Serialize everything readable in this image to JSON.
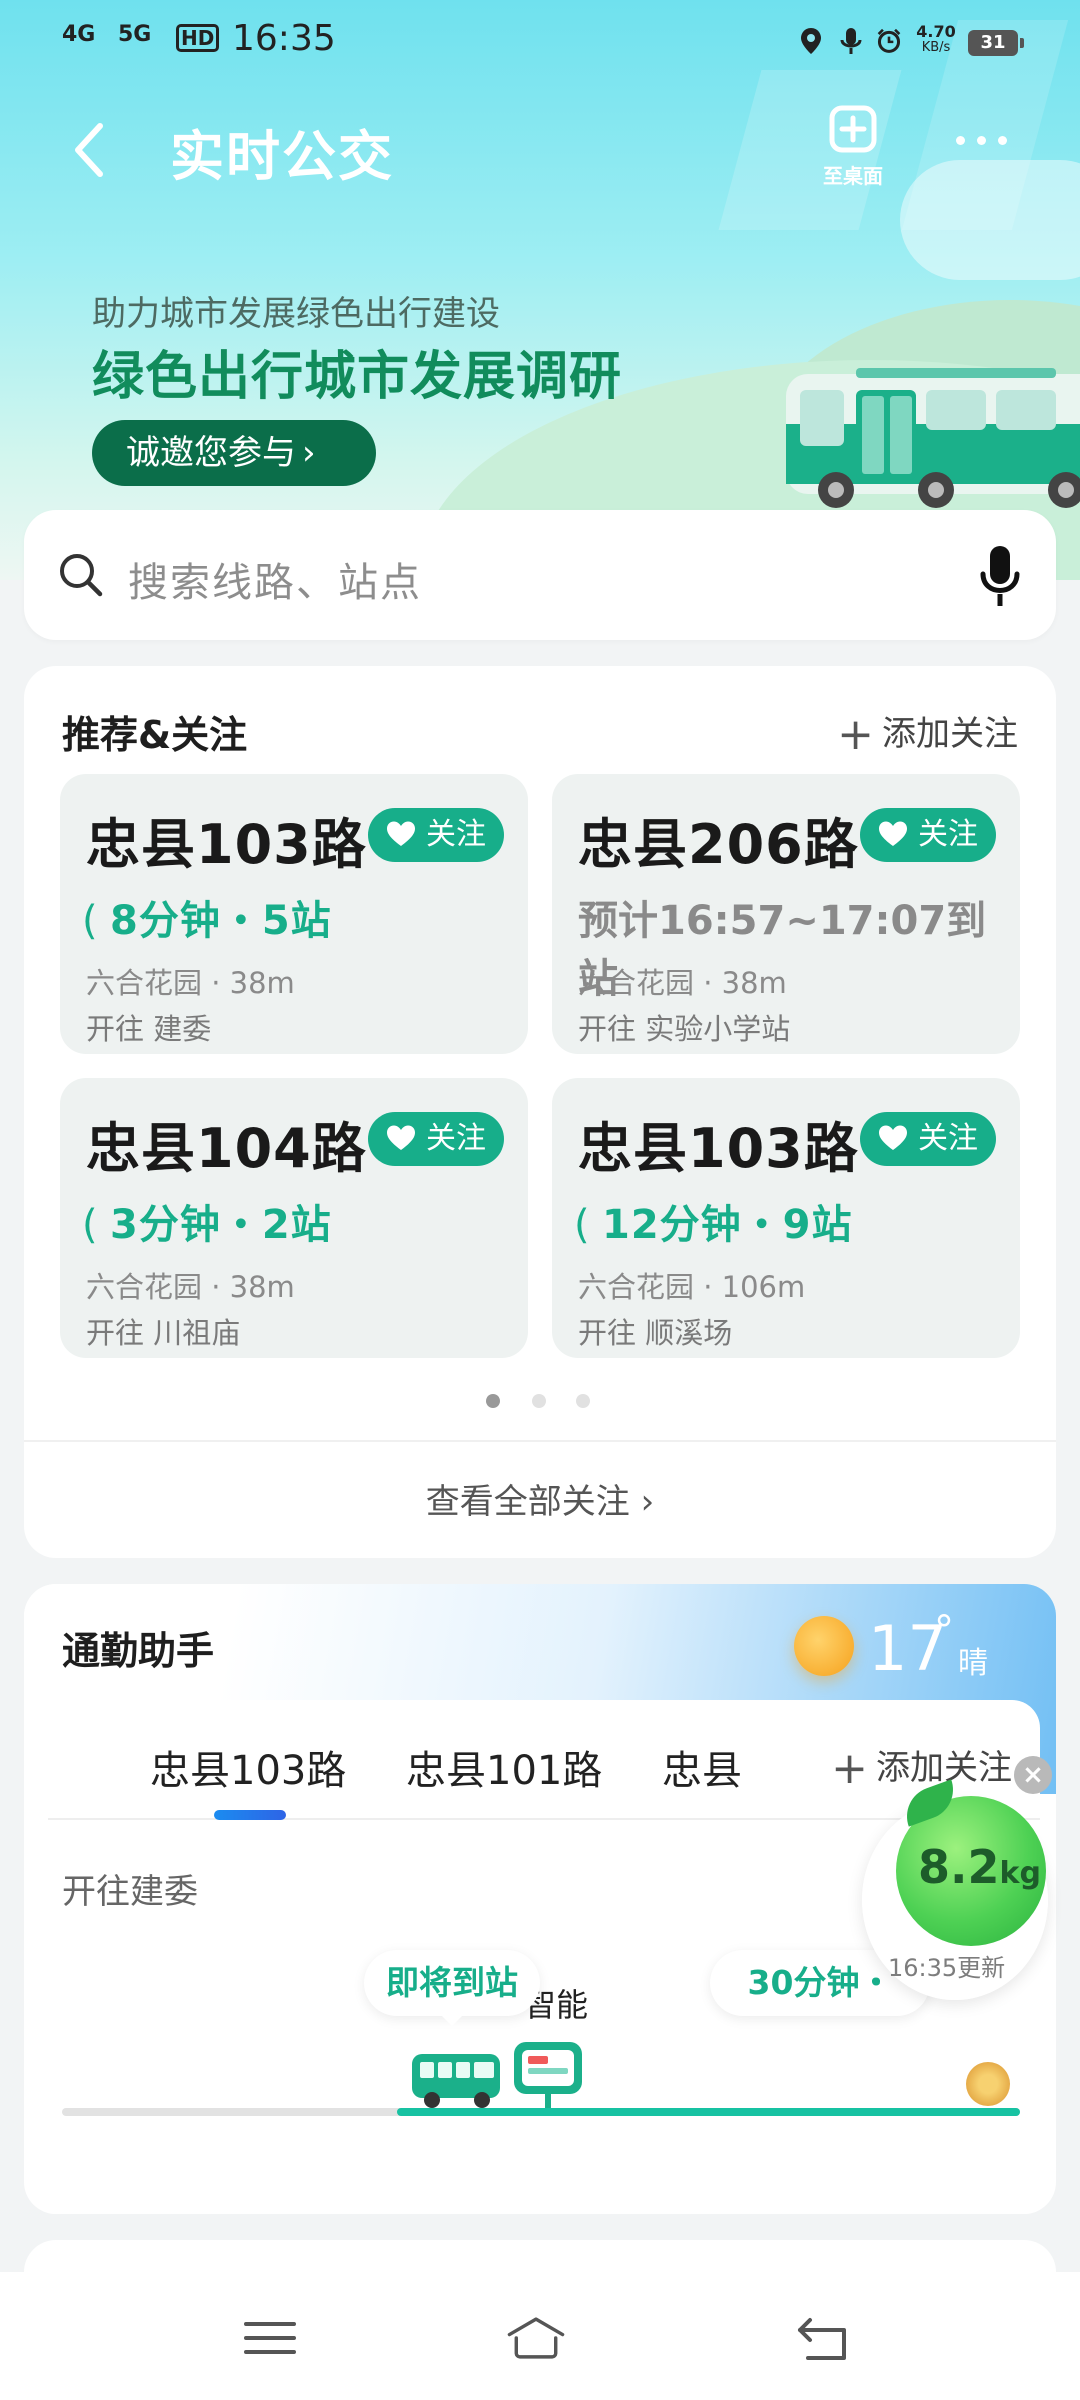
{
  "status": {
    "signal1": "4G",
    "signal2": "5G",
    "hd": "HD",
    "time": "16:35",
    "speed_value": "4.70",
    "speed_unit": "KB/s",
    "battery": "31"
  },
  "header": {
    "title": "实时公交",
    "desk_label": "至桌面"
  },
  "banner": {
    "subtitle": "助力城市发展绿色出行建设",
    "title": "绿色出行城市发展调研",
    "button": "诚邀您参与"
  },
  "search": {
    "placeholder": "搜索线路、站点"
  },
  "recommend": {
    "title": "推荐&关注",
    "add_label": "添加关注",
    "follow_label": "关注",
    "tiles": [
      {
        "route": "忠县103路",
        "eta": "8分钟・5站",
        "stop": "六合花园 · 38m",
        "dir": "开往 建委"
      },
      {
        "route": "忠县206路",
        "eta": "预计16:57~17:07到站",
        "stop": "六合花园 · 38m",
        "dir": "开往 实验小学站"
      },
      {
        "route": "忠县104路",
        "eta": "3分钟・2站",
        "stop": "六合花园 · 38m",
        "dir": "开往 川祖庙"
      },
      {
        "route": "忠县103路",
        "eta": "12分钟・9站",
        "stop": "六合花园 · 106m",
        "dir": "开往 顺溪场"
      }
    ],
    "view_all": "查看全部关注"
  },
  "commute": {
    "title": "通勤助手",
    "temperature": "17",
    "degree": "°",
    "condition": "晴",
    "tabs": [
      "忠县103路",
      "忠县101路",
      "忠县"
    ],
    "add_label": "添加关注",
    "direction": "开往建委",
    "arriving": "即将到站",
    "station": "智能",
    "next_eta": "30分钟・",
    "progress_fraction": 0.65
  },
  "eco": {
    "value": "8.2",
    "unit": "kg",
    "updated": "16:35更新",
    "close": "×"
  },
  "colors": {
    "accent": "#17ae8a",
    "banner_green": "#118c5c",
    "banner_button": "#0b6e4a",
    "tab_indicator": "#1b8cf0"
  }
}
